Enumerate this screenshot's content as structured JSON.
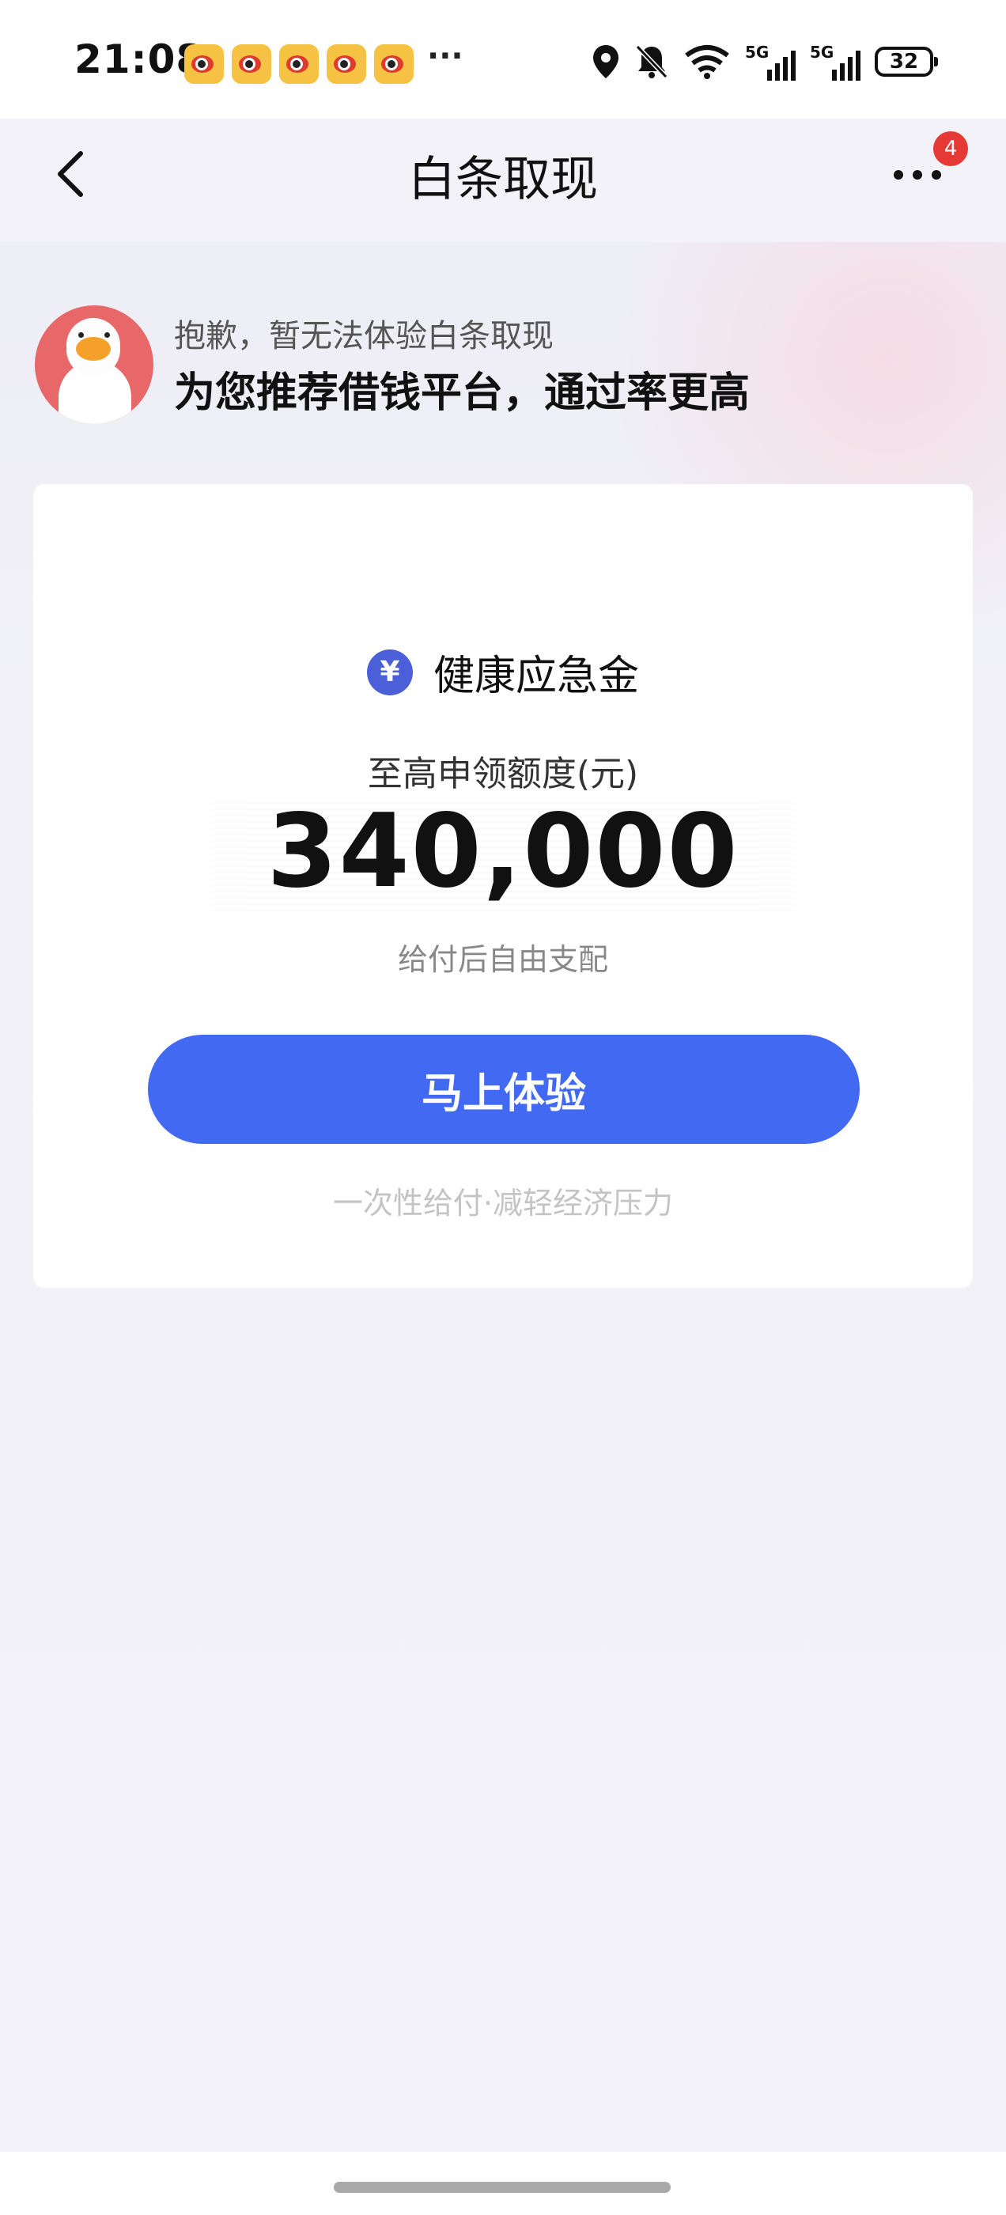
{
  "status_bar": {
    "time": "21:08",
    "notification_icons": [
      "weibo-icon",
      "weibo-icon",
      "weibo-icon",
      "weibo-icon",
      "weibo-icon"
    ],
    "more": "···",
    "network_1": "5G",
    "network_2": "5G",
    "battery": "32"
  },
  "nav": {
    "title": "白条取现",
    "badge_count": "4"
  },
  "header": {
    "sorry_text": "抱歉，暂无法体验白条取现",
    "headline": "为您推荐借钱平台，通过率更高"
  },
  "card": {
    "product_icon": "¥",
    "product_name": "健康应急金",
    "limit_label": "至高申领额度(元)",
    "amount": "340,000",
    "free_use": "给付后自由支配",
    "cta_label": "马上体验",
    "footnote": "一次性给付·减轻经济压力"
  },
  "colors": {
    "accent_blue": "#4169f2",
    "icon_blue": "#4a5fd8",
    "badge_red": "#e53935",
    "background": "#f3f2f8"
  }
}
